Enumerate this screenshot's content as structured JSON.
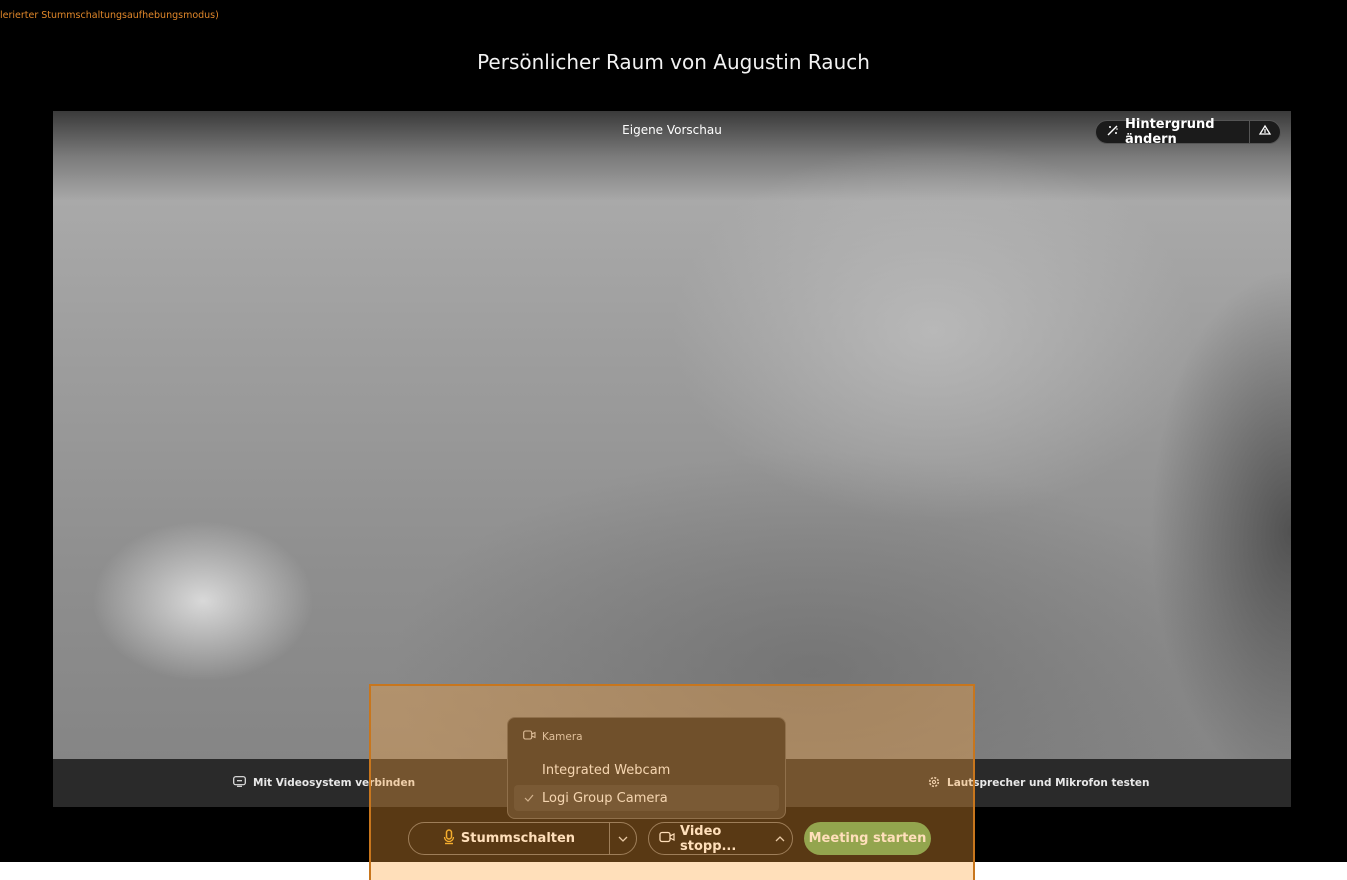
{
  "status": {
    "mode_label": "lerierter Stummschaltungsaufhebungsmodus)"
  },
  "header": {
    "title": "Persönlicher Raum von Augustin Rauch"
  },
  "preview": {
    "label": "Eigene Vorschau",
    "background_button_label": "Hintergrund ändern",
    "background_button_icon": "magic-wand-icon",
    "extra_button_icon": "person-upload-icon"
  },
  "bottom_bar": {
    "video_system_label": "Mit Videosystem verbinden",
    "video_system_icon": "cast-screen-icon",
    "test_audio_label": "Lautsprecher und Mikrofon testen",
    "test_audio_icon": "gear-icon"
  },
  "controls": {
    "mute_label": "Stummschalten",
    "mute_icon": "microphone-icon",
    "video_label": "Video stopp...",
    "video_icon": "camera-icon",
    "start_label": "Meeting starten",
    "mic_color": "#f0b429",
    "start_color": "#5aa75a"
  },
  "camera_menu": {
    "title": "Kamera",
    "options": [
      {
        "label": "Integrated Webcam",
        "selected": false
      },
      {
        "label": "Logi Group Camera",
        "selected": true
      }
    ]
  },
  "highlight": {
    "color": "#c8761d"
  }
}
